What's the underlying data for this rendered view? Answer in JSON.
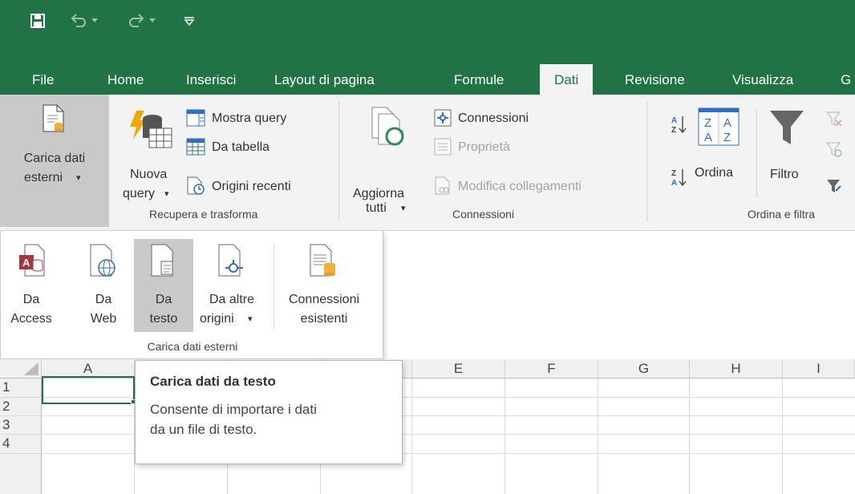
{
  "tabs": [
    "File",
    "Home",
    "Inserisci",
    "Layout di pagina",
    "Formule",
    "Dati",
    "Revisione",
    "Visualizza",
    "G"
  ],
  "active_tab": "Dati",
  "ribbon": {
    "carica_line1": "Carica dati",
    "carica_line2": "esterni",
    "nuova_line1": "Nuova",
    "nuova_line2": "query",
    "mostra_query": "Mostra query",
    "da_tabella": "Da tabella",
    "origini_recenti": "Origini recenti",
    "group_recupera": "Recupera e trasforma",
    "aggiorna_line1": "Aggiorna",
    "aggiorna_line2": "tutti",
    "connessioni": "Connessioni",
    "proprieta": "Proprietà",
    "modifica_collegamenti": "Modifica collegamenti",
    "group_connessioni": "Connessioni",
    "ordina": "Ordina",
    "filtro": "Filtro",
    "group_ordina": "Ordina e filtra",
    "dropdown_arrow": "▾"
  },
  "dropdown": {
    "items": [
      {
        "line1": "Da",
        "line2": "Access"
      },
      {
        "line1": "Da",
        "line2": "Web"
      },
      {
        "line1": "Da",
        "line2": "testo"
      },
      {
        "line1": "Da altre",
        "line2": "origini"
      },
      {
        "line1": "Connessioni",
        "line2": "esistenti"
      }
    ],
    "group_label": "Carica dati esterni"
  },
  "grid": {
    "columns": [
      "A",
      "B",
      "C",
      "D",
      "E",
      "F",
      "G",
      "H",
      "I"
    ],
    "rows": [
      "1",
      "2",
      "3",
      "4"
    ]
  },
  "tooltip": {
    "title": "Carica dati da testo",
    "body_line1": "Consente di importare i dati",
    "body_line2": "da un file di testo."
  },
  "colors": {
    "excel_green": "#217346",
    "hover_gray": "#c9c9c9"
  }
}
